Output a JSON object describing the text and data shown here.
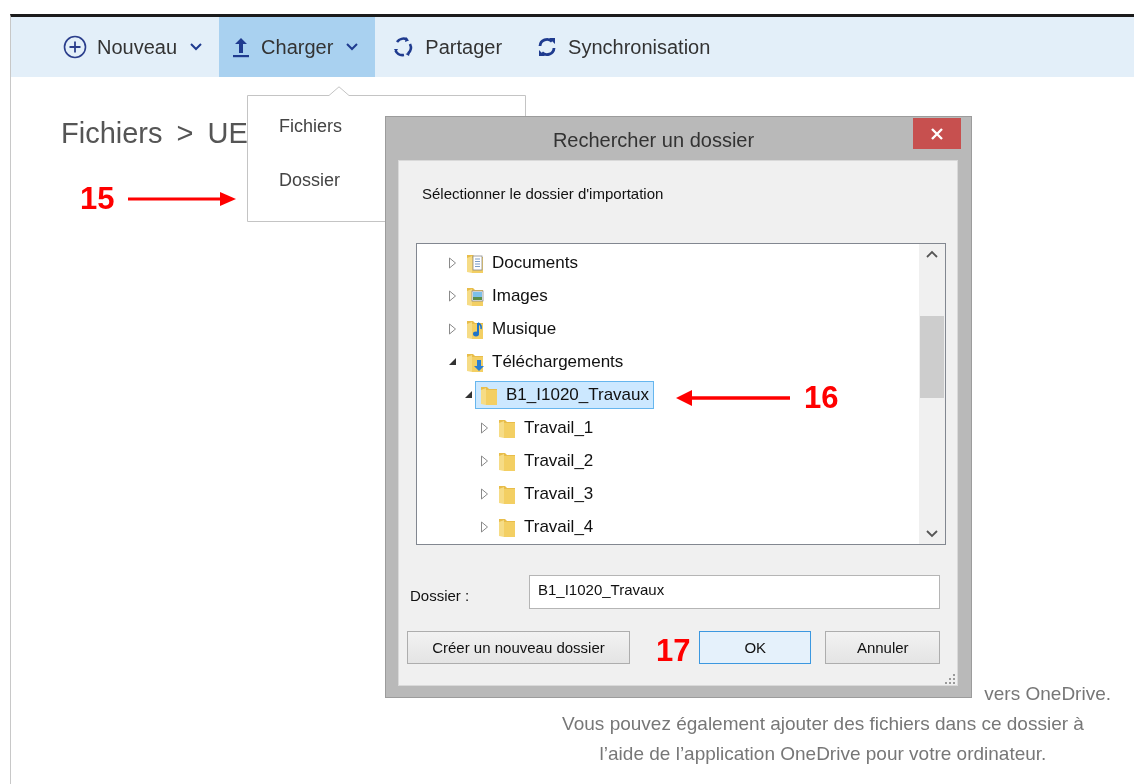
{
  "toolbar": {
    "items": [
      {
        "label": "Nouveau",
        "kind": "new",
        "has_menu": true,
        "selected": false
      },
      {
        "label": "Charger",
        "kind": "upload",
        "has_menu": true,
        "selected": true
      },
      {
        "label": "Partager",
        "kind": "share",
        "has_menu": false,
        "selected": false
      },
      {
        "label": "Synchronisation",
        "kind": "sync",
        "has_menu": false,
        "selected": false
      }
    ]
  },
  "breadcrumb": {
    "items": [
      "Fichiers",
      "UE"
    ],
    "separator": ">"
  },
  "upload_menu": {
    "items": [
      {
        "label": "Fichiers"
      },
      {
        "label": "Dossier"
      }
    ]
  },
  "drop_hint": {
    "lines": [
      "vers OneDrive.",
      "Vous pouvez également ajouter des fichiers dans ce dossier à",
      "l’aide de l’application OneDrive pour votre ordinateur."
    ]
  },
  "dialog": {
    "title": "Rechercher un dossier",
    "prompt": "Sélectionner le dossier d'importation",
    "tree": [
      {
        "label": "Documents",
        "kind": "documents",
        "expanded": false,
        "selected": false
      },
      {
        "label": "Images",
        "kind": "images",
        "expanded": false,
        "selected": false
      },
      {
        "label": "Musique",
        "kind": "music",
        "expanded": false,
        "selected": false
      },
      {
        "label": "Téléchargements",
        "kind": "downloads",
        "expanded": true,
        "selected": false,
        "children": [
          {
            "label": "B1_I1020_Travaux",
            "kind": "folder",
            "expanded": true,
            "selected": true,
            "children": [
              {
                "label": "Travail_1",
                "kind": "folder",
                "expanded": false,
                "selected": false
              },
              {
                "label": "Travail_2",
                "kind": "folder",
                "expanded": false,
                "selected": false
              },
              {
                "label": "Travail_3",
                "kind": "folder",
                "expanded": false,
                "selected": false
              },
              {
                "label": "Travail_4",
                "kind": "folder",
                "expanded": false,
                "selected": false
              }
            ]
          }
        ]
      }
    ],
    "folder_label": "Dossier :",
    "folder_value": "B1_I1020_Travaux",
    "buttons": [
      {
        "label": "Créer un nouveau dossier",
        "default": false
      },
      {
        "label": "OK",
        "default": true
      },
      {
        "label": "Annuler",
        "default": false
      }
    ]
  },
  "annotations": [
    {
      "label": "15",
      "kind": "rightarrow"
    },
    {
      "label": "16",
      "kind": "leftarrow"
    },
    {
      "label": "17",
      "kind": "plain"
    }
  ]
}
